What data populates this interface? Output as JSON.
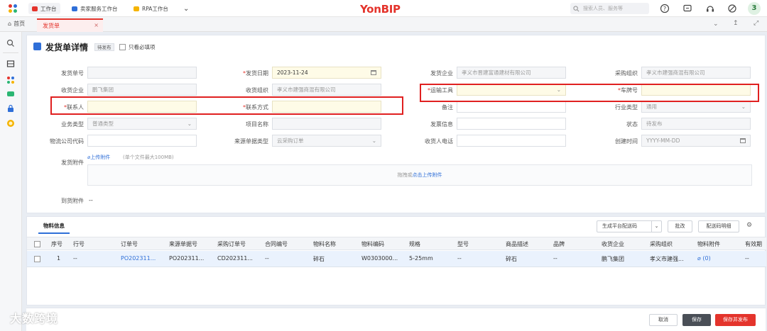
{
  "topbar": {
    "brand": "YonBIP",
    "workbench_tabs": [
      "工作台",
      "卖家服务工作台",
      "RPA工作台"
    ],
    "search_placeholder": "搜索人员、服务等",
    "avatar_text": "3"
  },
  "tabs": {
    "home": "首页",
    "active": "发货单",
    "close": "×"
  },
  "page": {
    "title": "发货单详情",
    "status_badge": "待发布",
    "only_required_label": "只看必填项"
  },
  "form": {
    "fields": {
      "ship_no": {
        "label": "发货单号",
        "value": ""
      },
      "ship_date": {
        "label": "发货日期",
        "value": "2023-11-24"
      },
      "ship_company": {
        "label": "发货企业",
        "value": "孝义市晋建富通建材有限公司"
      },
      "purchase_org": {
        "label": "采购组织",
        "value": "孝义市建强商混有限公司"
      },
      "recv_company": {
        "label": "收货企业",
        "value": "鹏飞集团"
      },
      "recv_org": {
        "label": "收货组织",
        "value": "孝义市建强商混有限公司"
      },
      "transport": {
        "label": "运输工具",
        "value": ""
      },
      "plate_no": {
        "label": "车牌号",
        "value": ""
      },
      "contact": {
        "label": "联系人",
        "value": ""
      },
      "contact_method": {
        "label": "联系方式",
        "value": ""
      },
      "remark": {
        "label": "备注",
        "value": ""
      },
      "industry": {
        "label": "行业类型",
        "value": "通用"
      },
      "biz_type": {
        "label": "业务类型",
        "value": "普通类型"
      },
      "project": {
        "label": "项目名称",
        "value": ""
      },
      "ship_info": {
        "label": "发票信息",
        "value": ""
      },
      "state": {
        "label": "状态",
        "value": "待发布"
      },
      "logistics_code": {
        "label": "物流公司代码",
        "value": ""
      },
      "source_type": {
        "label": "来源单据类型",
        "value": "云采购订单"
      },
      "receiver_phone": {
        "label": "收货人电话",
        "value": ""
      },
      "create_time": {
        "label": "创建时间",
        "value": "YYYY-MM-DD"
      },
      "attachment": {
        "label": "发货附件"
      },
      "arrival_attachment": {
        "label": "到货附件",
        "value": "--"
      }
    },
    "upload_link": "上传附件",
    "upload_hint": "(单个文件最大100MB)",
    "drop_hint": "拖拽或",
    "drop_link": "点击上传附件"
  },
  "table": {
    "tab_label": "物料信息",
    "buttons": {
      "gen_delivery": "生成平台配送码",
      "batch": "批改",
      "delivery_detail": "配送码明细"
    },
    "columns": [
      "序号",
      "行号",
      "订单号",
      "来源单据号",
      "采购订单号",
      "合同编号",
      "物料名称",
      "物料编码",
      "规格",
      "型号",
      "商品描述",
      "品牌",
      "收货企业",
      "采购组织",
      "物料附件",
      "有效期"
    ],
    "rows": [
      [
        "1",
        "--",
        "PO202311...",
        "PO202311...",
        "CD202311...",
        "--",
        "碎石",
        "W0303000...",
        "5-25mm",
        "--",
        "碎石",
        "--",
        "鹏飞集团",
        "孝义市建强...",
        "(0)",
        "--"
      ]
    ]
  },
  "footer": {
    "cancel": "取消",
    "save": "保存",
    "save_publish": "保存并发布"
  },
  "watermark": "大数跨境",
  "colors": {
    "brand_red": "#e4342c",
    "primary_blue": "#2f6fd8",
    "highlight_red": "#e02020"
  }
}
